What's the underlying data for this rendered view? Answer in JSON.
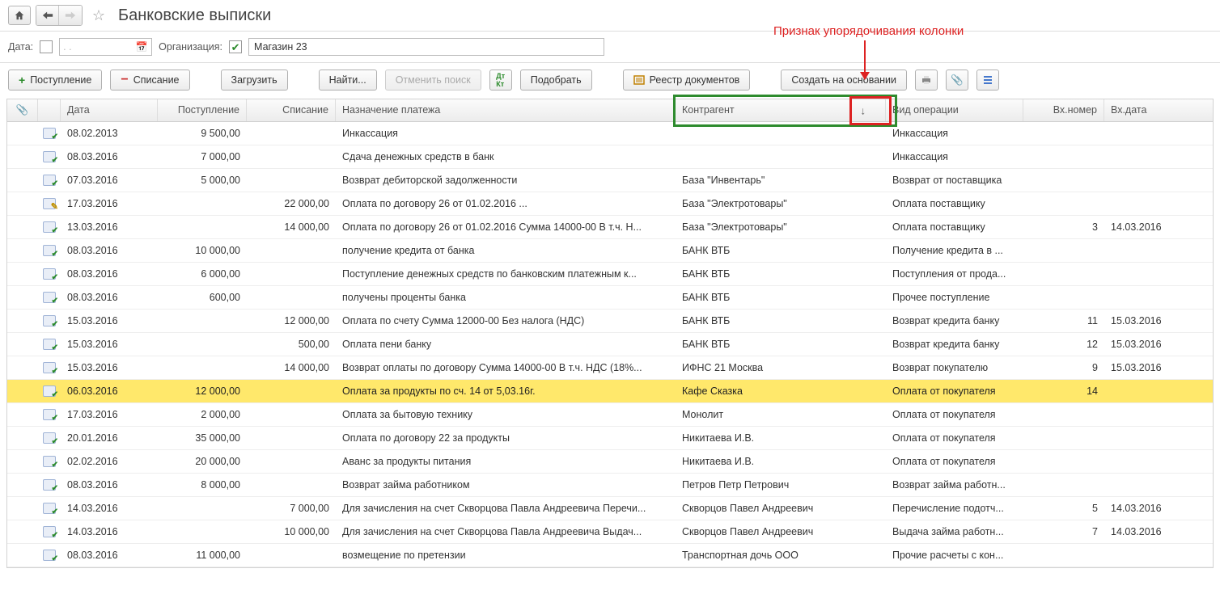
{
  "header": {
    "title": "Банковские выписки"
  },
  "filters": {
    "date_label": "Дата:",
    "date_placeholder": ".    .",
    "org_label": "Организация:",
    "org_checked": true,
    "org_value": "Магазин 23"
  },
  "toolbar": {
    "income": "Поступление",
    "outcome": "Списание",
    "load": "Загрузить",
    "find": "Найти...",
    "cancel_search": "Отменить поиск",
    "pick": "Подобрать",
    "registry": "Реестр документов",
    "create_based": "Создать на основании"
  },
  "columns": {
    "attach": "📎",
    "date": "Дата",
    "income": "Поступление",
    "outcome": "Списание",
    "purpose": "Назначение платежа",
    "counterparty": "Контрагент",
    "op_type": "Вид операции",
    "in_num": "Вх.номер",
    "in_date": "Вх.дата",
    "sort_arrow": "↓"
  },
  "annotation": {
    "text": "Признак упорядочивания колонки"
  },
  "rows": [
    {
      "icon": "ok",
      "date": "08.02.2013",
      "in": "9 500,00",
      "out": "",
      "purpose": "Инкассация",
      "cp": "",
      "op": "Инкассация",
      "num": "",
      "idate": ""
    },
    {
      "icon": "ok",
      "date": "08.03.2016",
      "in": "7 000,00",
      "out": "",
      "purpose": "Сдача денежных средств в банк",
      "cp": "",
      "op": "Инкассация",
      "num": "",
      "idate": ""
    },
    {
      "icon": "ok",
      "date": "07.03.2016",
      "in": "5 000,00",
      "out": "",
      "purpose": "Возврат дебиторской задолженности",
      "cp": "База \"Инвентарь\"",
      "op": "Возврат от поставщика",
      "num": "",
      "idate": ""
    },
    {
      "icon": "edit",
      "date": "17.03.2016",
      "in": "",
      "out": "22 000,00",
      "purpose": "Оплата по договору 26 от 01.02.2016 ...",
      "cp": "База \"Электротовары\"",
      "op": "Оплата поставщику",
      "num": "",
      "idate": ""
    },
    {
      "icon": "ok",
      "date": "13.03.2016",
      "in": "",
      "out": "14 000,00",
      "purpose": "Оплата по договору 26 от 01.02.2016 Сумма 14000-00 В т.ч. Н...",
      "cp": "База \"Электротовары\"",
      "op": "Оплата поставщику",
      "num": "3",
      "idate": "14.03.2016"
    },
    {
      "icon": "ok",
      "date": "08.03.2016",
      "in": "10 000,00",
      "out": "",
      "purpose": "получение кредита от банка",
      "cp": "БАНК ВТБ",
      "op": "Получение кредита в ...",
      "num": "",
      "idate": ""
    },
    {
      "icon": "ok",
      "date": "08.03.2016",
      "in": "6 000,00",
      "out": "",
      "purpose": "Поступление денежных средств по банковским платежным к...",
      "cp": "БАНК ВТБ",
      "op": "Поступления от прода...",
      "num": "",
      "idate": ""
    },
    {
      "icon": "ok",
      "date": "08.03.2016",
      "in": "600,00",
      "out": "",
      "purpose": "получены проценты банка",
      "cp": "БАНК ВТБ",
      "op": "Прочее поступление",
      "num": "",
      "idate": ""
    },
    {
      "icon": "ok",
      "date": "15.03.2016",
      "in": "",
      "out": "12 000,00",
      "purpose": "Оплата по счету Сумма 12000-00 Без налога (НДС)",
      "cp": "БАНК ВТБ",
      "op": "Возврат кредита банку",
      "num": "11",
      "idate": "15.03.2016"
    },
    {
      "icon": "ok",
      "date": "15.03.2016",
      "in": "",
      "out": "500,00",
      "purpose": "Оплата пени банку",
      "cp": "БАНК ВТБ",
      "op": "Возврат кредита банку",
      "num": "12",
      "idate": "15.03.2016"
    },
    {
      "icon": "ok",
      "date": "15.03.2016",
      "in": "",
      "out": "14 000,00",
      "purpose": "Возврат оплаты по договору Сумма 14000-00 В т.ч. НДС  (18%...",
      "cp": "ИФНС 21 Москва",
      "op": "Возврат покупателю",
      "num": "9",
      "idate": "15.03.2016"
    },
    {
      "icon": "ok",
      "date": "06.03.2016",
      "in": "12 000,00",
      "out": "",
      "purpose": "Оплата за продукты по сч. 14 от 5,03.16г.",
      "cp": "Кафе Сказка",
      "op": "Оплата от покупателя",
      "num": "14",
      "idate": "",
      "selected": true
    },
    {
      "icon": "ok",
      "date": "17.03.2016",
      "in": "2 000,00",
      "out": "",
      "purpose": "Оплата за бытовую технику",
      "cp": "Монолит",
      "op": "Оплата от покупателя",
      "num": "",
      "idate": ""
    },
    {
      "icon": "ok",
      "date": "20.01.2016",
      "in": "35 000,00",
      "out": "",
      "purpose": "Оплата по договору 22 за продукты",
      "cp": "Никитаева И.В.",
      "op": "Оплата от покупателя",
      "num": "",
      "idate": ""
    },
    {
      "icon": "ok",
      "date": "02.02.2016",
      "in": "20 000,00",
      "out": "",
      "purpose": "Аванс за продукты питания",
      "cp": "Никитаева И.В.",
      "op": "Оплата от покупателя",
      "num": "",
      "idate": ""
    },
    {
      "icon": "ok",
      "date": "08.03.2016",
      "in": "8 000,00",
      "out": "",
      "purpose": "Возврат займа работником",
      "cp": "Петров Петр Петрович",
      "op": "Возврат займа работн...",
      "num": "",
      "idate": ""
    },
    {
      "icon": "ok",
      "date": "14.03.2016",
      "in": "",
      "out": "7 000,00",
      "purpose": "Для зачисления на счет Скворцова Павла Андреевича Перечи...",
      "cp": "Скворцов Павел Андреевич",
      "op": "Перечисление подотч...",
      "num": "5",
      "idate": "14.03.2016"
    },
    {
      "icon": "ok",
      "date": "14.03.2016",
      "in": "",
      "out": "10 000,00",
      "purpose": "Для зачисления на счет Скворцова Павла Андреевича Выдач...",
      "cp": "Скворцов Павел Андреевич",
      "op": "Выдача займа работн...",
      "num": "7",
      "idate": "14.03.2016"
    },
    {
      "icon": "ok",
      "date": "08.03.2016",
      "in": "11 000,00",
      "out": "",
      "purpose": "возмещение по претензии",
      "cp": "Транспортная дочь ООО",
      "op": "Прочие расчеты с кон...",
      "num": "",
      "idate": ""
    }
  ]
}
